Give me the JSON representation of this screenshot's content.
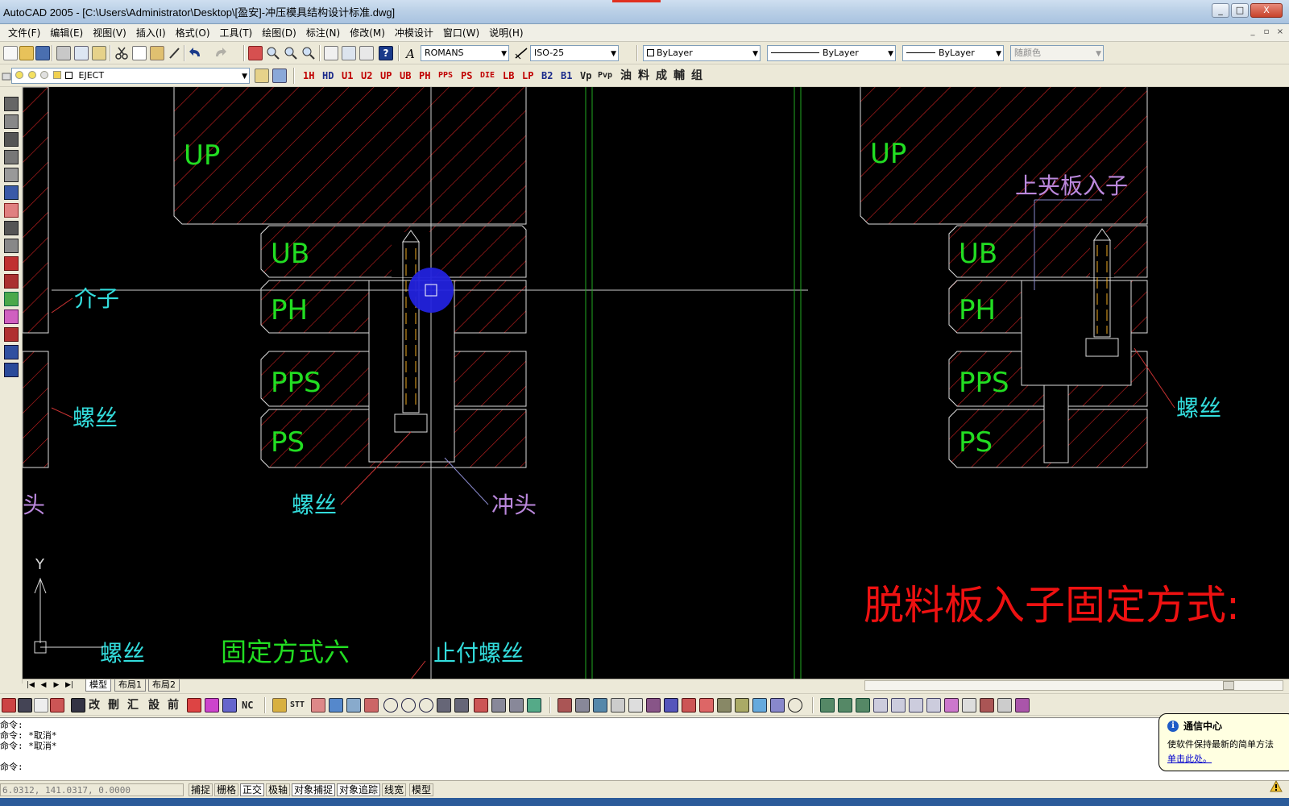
{
  "window": {
    "title": "AutoCAD 2005 - [C:\\Users\\Administrator\\Desktop\\[盈安]-冲压模具结构设计标准.dwg]",
    "minimize": "_",
    "maximize": "□",
    "close": "X"
  },
  "menu": {
    "items": [
      "文件(F)",
      "编辑(E)",
      "视图(V)",
      "插入(I)",
      "格式(O)",
      "工具(T)",
      "绘图(D)",
      "标注(N)",
      "修改(M)",
      "冲模设计",
      "窗口(W)",
      "说明(H)"
    ],
    "doc_controls": [
      "_",
      "▫",
      "×"
    ]
  },
  "toolbar1": {
    "text_style": "ROMANS",
    "dim_style": "ISO-25",
    "color": "ByLayer",
    "linetype": "ByLayer",
    "lineweight": "ByLayer",
    "plot_style": "随颜色"
  },
  "toolbar2": {
    "layer": "EJECT",
    "buttons": [
      "1H",
      "HD",
      "U1",
      "U2",
      "UP",
      "UB",
      "PH",
      "PPS",
      "PS",
      "DIE",
      "LB",
      "LP",
      "B2",
      "B1",
      "Vp",
      "Pvp"
    ],
    "cn_buttons": [
      "油",
      "料",
      "成",
      "輔",
      "组"
    ]
  },
  "drawing": {
    "plates_left": [
      "UP",
      "UB",
      "PH",
      "PPS",
      "PS"
    ],
    "plates_right": [
      "UP",
      "UB",
      "PH",
      "PPS",
      "PS"
    ],
    "labels": {
      "jiezi": "介子",
      "luosi_left": "螺丝",
      "tou_partial": "头",
      "luosi_center": "螺丝",
      "chongtou": "冲头",
      "luosi_bottom": "螺丝",
      "guding6": "固定方式六",
      "zhifu": "止付螺丝",
      "shangjia": "上夹板入子",
      "luosi_right": "螺丝",
      "tuoliao": "脱料板入子固定方式:"
    },
    "ucs_y": "Y"
  },
  "layout_tabs": [
    "模型",
    "布局1",
    "布局2"
  ],
  "toolbar3": {
    "cn_buttons": [
      "改",
      "刪",
      "汇",
      "設",
      "前"
    ],
    "code_buttons": [
      "NC",
      "STT"
    ]
  },
  "command": {
    "lines": [
      "命令:",
      "命令: *取消*",
      "命令: *取消*",
      "",
      "命令:"
    ]
  },
  "status": {
    "coords": "6.0312, 141.0317, 0.0000",
    "buttons": [
      {
        "label": "捕捉",
        "on": false
      },
      {
        "label": "栅格",
        "on": false
      },
      {
        "label": "正交",
        "on": true
      },
      {
        "label": "极轴",
        "on": false
      },
      {
        "label": "对象捕捉",
        "on": true
      },
      {
        "label": "对象追踪",
        "on": true
      },
      {
        "label": "线宽",
        "on": false
      },
      {
        "label": "模型",
        "on": false
      }
    ]
  },
  "balloon": {
    "title": "通信中心",
    "text": "使软件保持最新的简单方法",
    "link": "单击此处。"
  },
  "colors": {
    "canvas": "#000000",
    "plate_label": "#22dd22",
    "cyan_label": "#33dddd",
    "purple_label": "#bb88dd",
    "red_title": "#ee1111",
    "hatch": "#cc2222",
    "outline": "#dddddd"
  }
}
